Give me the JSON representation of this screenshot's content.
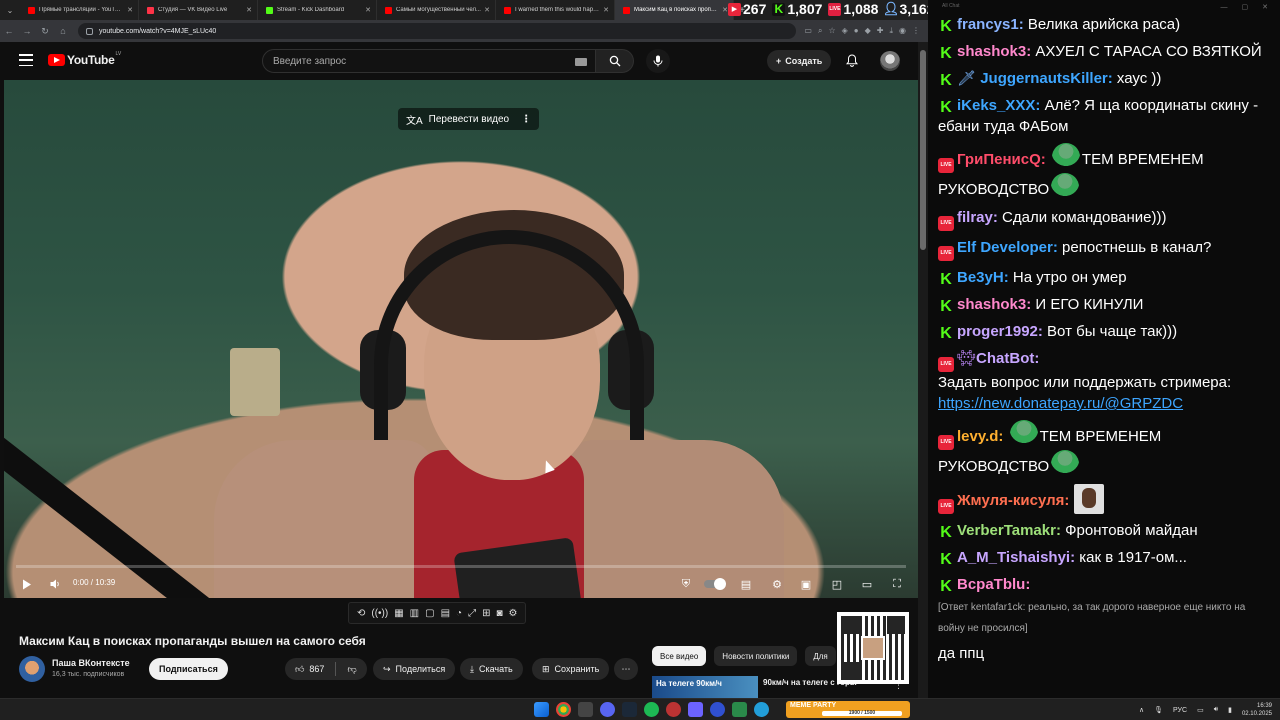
{
  "browser": {
    "tabs": [
      {
        "title": "Прямые трансляции - YouTube",
        "color": "#ff0000",
        "active": false
      },
      {
        "title": "Студия — VK Видео Live",
        "color": "#ff3347",
        "active": false
      },
      {
        "title": "Stream - Kick Dashboard",
        "color": "#53fc18",
        "active": false
      },
      {
        "title": "Самый могущественный чел...",
        "color": "#ff0000",
        "active": false
      },
      {
        "title": "I warned them this would happ...",
        "color": "#ff0000",
        "active": false
      },
      {
        "title": "Максим Кац в поисках пропага...",
        "color": "#ff0000",
        "active": true
      }
    ],
    "url": "youtube.com/watch?v=4MJE_sLUc40"
  },
  "youtube": {
    "logo_text": "YouTube",
    "logo_country": "LV",
    "search_placeholder": "Введите запрос",
    "create_label": "Создать",
    "translate_label": "Перевести видео",
    "time": "0:00 / 10:39",
    "progress": 0,
    "video_title": "Максим Кац в поисках пропаганды вышел на самого себя",
    "channel_name": "Паша ВКонтексте",
    "channel_subs": "16,3 тыс. подписчиков",
    "subscribe_label": "Подписаться",
    "likes": "867",
    "share_label": "Поделиться",
    "download_label": "Скачать",
    "save_label": "Сохранить",
    "chips": [
      "Все видео",
      "Новости политики",
      "Для"
    ],
    "rec_thumb_text": "На телеге 90км/ч",
    "rec_title": "90км/ч на телеге с горы"
  },
  "stats": {
    "youtube": "267",
    "kick": "1,807",
    "vk": "1,088",
    "total": "3,162"
  },
  "chat": {
    "window_title": "All Chat",
    "messages": [
      {
        "platform": "kick",
        "nick": "francys1",
        "color": "#8ab4ff",
        "text": "Велика арийска раса)"
      },
      {
        "platform": "kick",
        "nick": "shashok3",
        "color": "#ff88cc",
        "text": "АХУЕЛ С ТАРАСА СО ВЗЯТКОЙ"
      },
      {
        "platform": "kick",
        "nick": "JuggernautsKiller",
        "color": "#3ea6ff",
        "text": "хаус ))",
        "sword": true
      },
      {
        "platform": "kick",
        "nick": "iKeks_XXX",
        "color": "#3ea6ff",
        "text": "Алё? Я ща координаты скину - ебани туда ФАБом"
      },
      {
        "platform": "live",
        "nick": "ГриПенисQ",
        "color": "#ff4d6a",
        "pre_emote": true,
        "text": "ТЕМ ВРЕМЕНЕМ РУКОВОДСТВО",
        "post_emote": true
      },
      {
        "platform": "live",
        "nick": "filray",
        "color": "#c7a6ff",
        "text": "Сдали командование)))"
      },
      {
        "platform": "live",
        "nick": "Elf Developer",
        "color": "#3ea6ff",
        "text": "репостнешь в канал?"
      },
      {
        "platform": "kick",
        "nick": "Ве3уН",
        "color": "#3ea6ff",
        "text": "На утро он умер"
      },
      {
        "platform": "kick",
        "nick": "shashok3",
        "color": "#ff88cc",
        "text": "И ЕГО КИНУЛИ"
      },
      {
        "platform": "kick",
        "nick": "proger1992",
        "color": "#c7a6ff",
        "text": "Вот бы чаще так)))"
      },
      {
        "platform": "live",
        "nick": "ChatBot",
        "color": "#c7a6ff",
        "bot": true,
        "text": "Задать вопрос или поддержать стримера:",
        "link": "https://new.donatepay.ru/@GRPZDC"
      },
      {
        "platform": "live",
        "nick": "levy.d",
        "color": "#ffb030",
        "pre_emote": true,
        "text": "ТЕМ ВРЕМЕНЕМ РУКОВОДСТВО",
        "post_emote": true
      },
      {
        "platform": "live",
        "nick": "Жмуля-кисуля",
        "color": "#ff6f50",
        "avatar_emote": true,
        "text": ""
      },
      {
        "platform": "kick",
        "nick": "VerberTamakr",
        "color": "#9ee07a",
        "text": "Фронтовой майдан"
      },
      {
        "platform": "kick",
        "nick": "A_M_Tishaishyi",
        "color": "#c7a6ff",
        "text": "как в 1917-ом..."
      },
      {
        "platform": "kick",
        "nick": "ВсраТblu",
        "color": "#ff88cc",
        "text": "",
        "reply": "[Ответ kentafar1ck: реально, за так дорого наверное еще никто на войну не просился]"
      },
      {
        "platform": "none",
        "nick": "",
        "color": "#ffffff",
        "text": "да ппц"
      }
    ]
  },
  "taskbar": {
    "media_text": "МЕМЕ PARTY",
    "media_progress": "1900 / 1500",
    "lang": "РУС",
    "time": "16:39",
    "date": "02.10.2025"
  }
}
